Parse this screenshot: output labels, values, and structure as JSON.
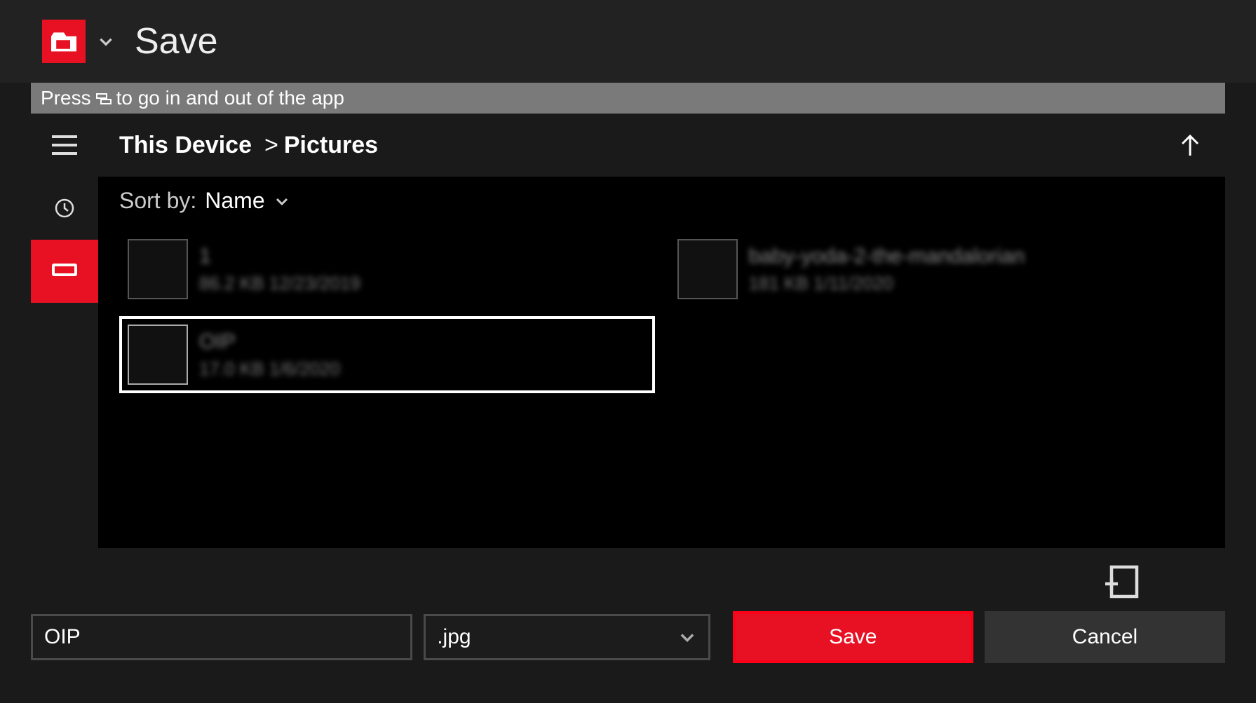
{
  "header": {
    "title": "Save"
  },
  "hint": {
    "prefix": "Press",
    "suffix": "to go in and out of the app"
  },
  "breadcrumb": {
    "root": "This Device",
    "separator": ">",
    "current": "Pictures"
  },
  "sort": {
    "label": "Sort by:",
    "value": "Name"
  },
  "files": [
    {
      "name": "1",
      "meta": "86.2 KB  12/23/2019",
      "selected": false
    },
    {
      "name": "baby-yoda-2-the-mandalorian",
      "meta": "181 KB  1/11/2020",
      "selected": false
    },
    {
      "name": "OIP",
      "meta": "17.0 KB  1/6/2020",
      "selected": true
    }
  ],
  "actions": {
    "filename": "OIP",
    "filetype": ".jpg",
    "save": "Save",
    "cancel": "Cancel"
  }
}
